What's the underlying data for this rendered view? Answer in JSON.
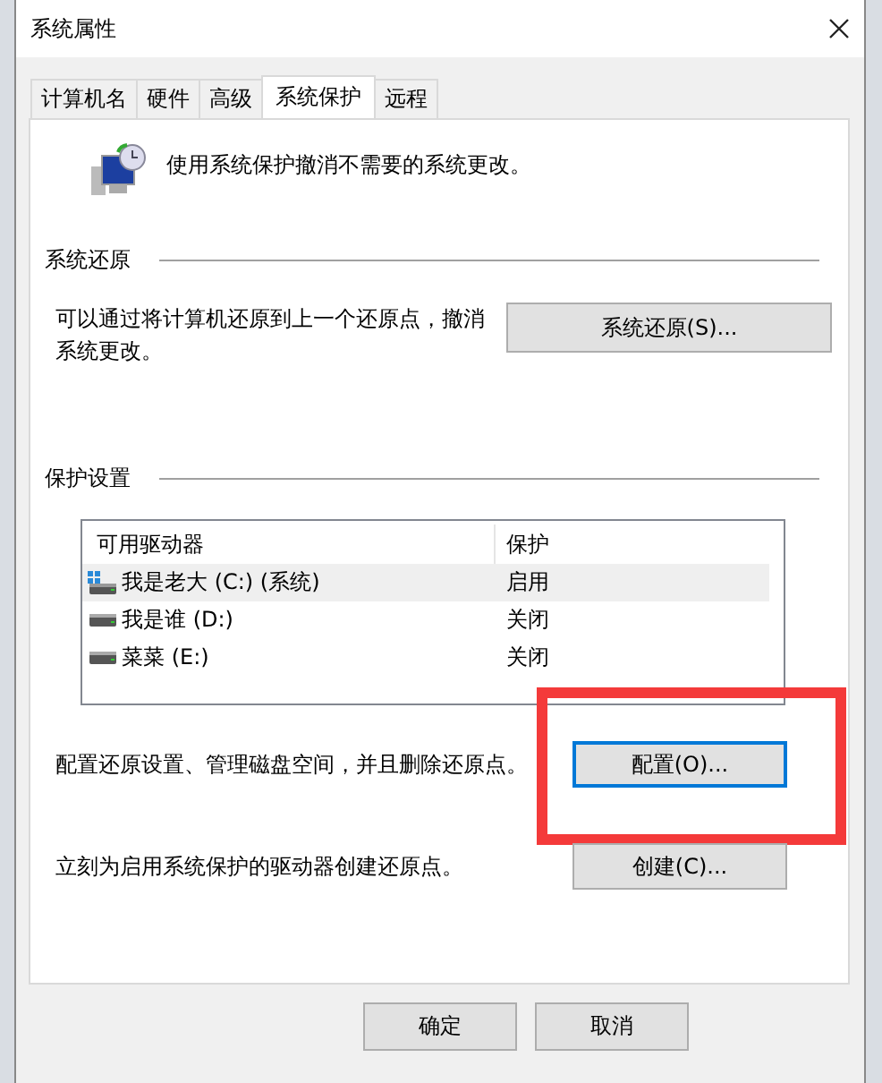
{
  "window": {
    "title": "系统属性"
  },
  "tabs": [
    {
      "label": "计算机名",
      "selected": false
    },
    {
      "label": "硬件",
      "selected": false
    },
    {
      "label": "高级",
      "selected": false
    },
    {
      "label": "系统保护",
      "selected": true
    },
    {
      "label": "远程",
      "selected": false
    }
  ],
  "intro": {
    "text": "使用系统保护撤消不需要的系统更改。"
  },
  "restore": {
    "title": "系统还原",
    "description": "可以通过将计算机还原到上一个还原点，撤消系统更改。",
    "button": "系统还原(S)..."
  },
  "protection": {
    "title": "保护设置",
    "columns": [
      "可用驱动器",
      "保护"
    ],
    "rows": [
      {
        "kind": "system",
        "drive": "我是老大 (C:) (系统)",
        "protection": "启用",
        "selected": true
      },
      {
        "kind": "drive",
        "drive": "我是谁 (D:)",
        "protection": "关闭",
        "selected": false
      },
      {
        "kind": "drive",
        "drive": "菜菜 (E:)",
        "protection": "关闭",
        "selected": false
      }
    ],
    "actions": [
      {
        "description": "配置还原设置、管理磁盘空间，并且删除还原点。",
        "button": "配置(O)...",
        "focused": true,
        "highlighted": true
      },
      {
        "description": "立刻为启用系统保护的驱动器创建还原点。",
        "button": "创建(C)...",
        "focused": false,
        "highlighted": false
      }
    ]
  },
  "footer_buttons": [
    {
      "label": "确定"
    },
    {
      "label": "取消"
    }
  ]
}
